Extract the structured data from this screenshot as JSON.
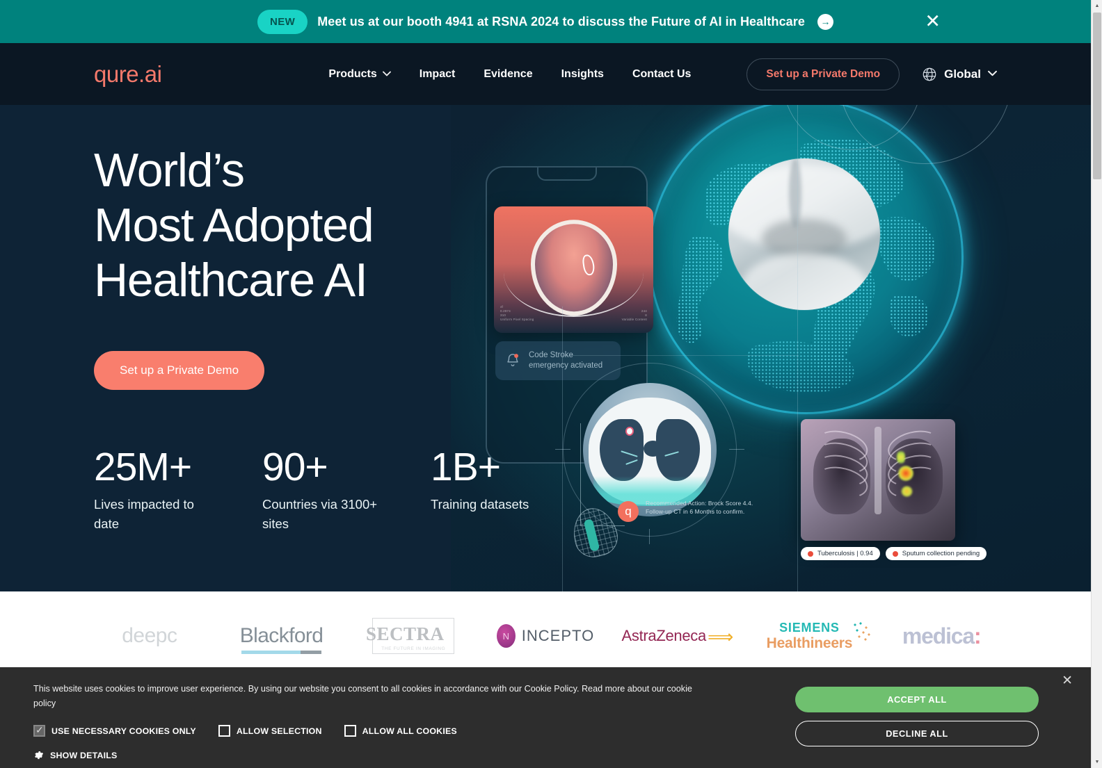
{
  "announcement": {
    "badge": "NEW",
    "text": "Meet us at our booth 4941 at RSNA 2024 to discuss the Future of AI in Healthcare",
    "arrow": "→",
    "close": "✕",
    "bg_color": "#00827d",
    "badge_color": "#19d3c5"
  },
  "navbar": {
    "logo": "qure.ai",
    "logo_color": "#f4796b",
    "links": [
      {
        "label": "Products",
        "has_dropdown": true,
        "chevron": "⌄"
      },
      {
        "label": "Impact",
        "has_dropdown": false
      },
      {
        "label": "Evidence",
        "has_dropdown": false
      },
      {
        "label": "Insights",
        "has_dropdown": false
      },
      {
        "label": "Contact Us",
        "has_dropdown": false
      }
    ],
    "demo_button": "Set up a Private Demo",
    "region": {
      "label": "Global",
      "chevron": "⌄",
      "icon": "globe-icon"
    }
  },
  "hero": {
    "heading_lines": [
      "World’s",
      "Most Adopted",
      "Healthcare AI"
    ],
    "cta": "Set up a Private Demo",
    "stats": [
      {
        "value": "25M+",
        "label": "Lives impacted  to date"
      },
      {
        "value": "90+",
        "label": "Countries via 3100+ sites"
      },
      {
        "value": "1B+",
        "label": "Training datasets"
      }
    ],
    "art": {
      "phone_notification": "Code Stroke emergency activated",
      "brain_meta_left": "4f\n0.2874\n310\nUniform Pixel Spacing",
      "brain_meta_right": "244\n8\nVariable Content",
      "recommendation": "Recommended Action: Brock Score 4.4. Follow-up CT in 6 Months to confirm.",
      "recommendation_badge": "q",
      "xray_tags": [
        {
          "text": "Tuberculosis | 0.94",
          "dot_color": "#ea4c3b"
        },
        {
          "text": "Sputum collection pending",
          "dot_color": "#ea4c3b"
        }
      ]
    }
  },
  "partners": [
    {
      "name": "deepc",
      "id": "logo-deepc"
    },
    {
      "name": "Blackford",
      "id": "logo-blackford"
    },
    {
      "name": "SECTRA",
      "sub": "THE FUTURE IN IMAGING",
      "id": "logo-sectra"
    },
    {
      "name": "INCEPTO",
      "mark": "N",
      "id": "logo-incepto"
    },
    {
      "name": "AstraZeneca",
      "id": "logo-astrazeneca"
    },
    {
      "name": "SIEMENS",
      "name2": "Healthineers",
      "id": "logo-siemens"
    },
    {
      "name": "medica",
      "accent": ":",
      "id": "logo-medica"
    }
  ],
  "cookie_banner": {
    "message": "This website uses cookies to improve user experience. By using our website you consent to all cookies in accordance with our Cookie Policy. Read more about our cookie policy",
    "options": [
      {
        "label": "USE NECESSARY COOKIES ONLY",
        "checked": true
      },
      {
        "label": "ALLOW SELECTION",
        "checked": false
      },
      {
        "label": "ALLOW ALL COOKIES",
        "checked": false
      }
    ],
    "show_details": "SHOW DETAILS",
    "accept_label": "ACCEPT ALL",
    "decline_label": "DECLINE ALL",
    "close": "✕",
    "accept_color": "#6fc06f",
    "bg_color": "#2d2d2d"
  },
  "scrollbar": {
    "up": "▲",
    "down": "▼"
  }
}
